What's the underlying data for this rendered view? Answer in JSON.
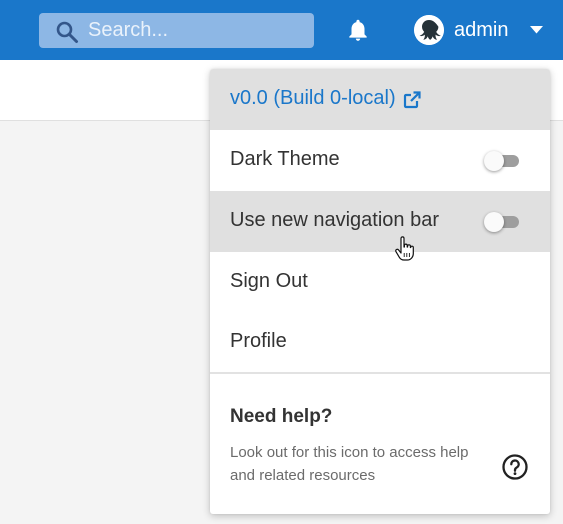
{
  "header": {
    "search": {
      "placeholder": "Search..."
    },
    "icons": {
      "search": "search-icon",
      "notifications": "bell-icon",
      "avatar": "octopus-avatar",
      "caret": "caret-down-icon"
    },
    "user": {
      "name": "admin"
    }
  },
  "menu": {
    "version": {
      "label": "v0.0 (Build 0-local)",
      "icon": "external-link-icon"
    },
    "items": [
      {
        "label": "Dark Theme",
        "toggle": false
      },
      {
        "label": "Use new navigation bar",
        "toggle": false
      },
      {
        "label": "Sign Out"
      },
      {
        "label": "Profile"
      }
    ],
    "help": {
      "title": "Need help?",
      "text": "Look out for this icon to access help and related resources",
      "icon": "help-circle-icon"
    }
  },
  "colors": {
    "header": "#1a77ca",
    "link": "#1a77ca",
    "highlight": "#e0e0e0"
  }
}
